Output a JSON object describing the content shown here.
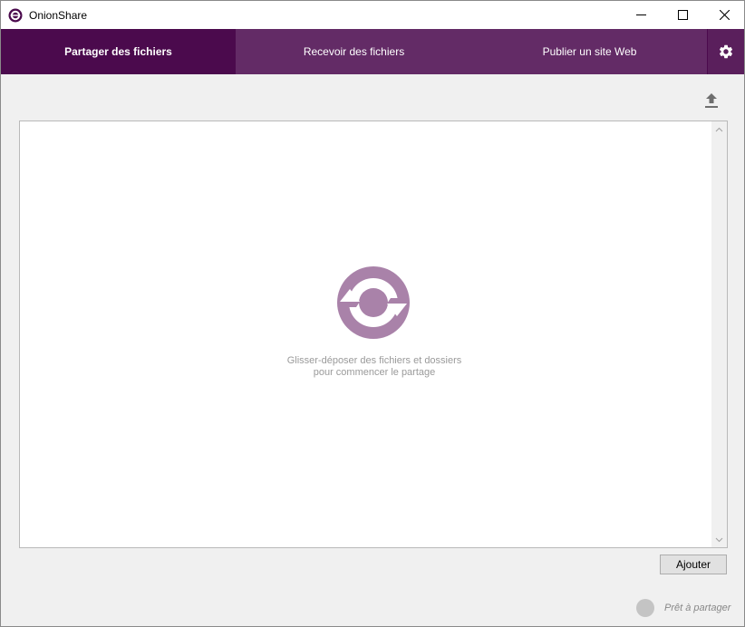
{
  "window": {
    "title": "OnionShare"
  },
  "tabs": [
    {
      "label": "Partager des fichiers",
      "active": true
    },
    {
      "label": "Recevoir des fichiers",
      "active": false
    },
    {
      "label": "Publier un site Web",
      "active": false
    }
  ],
  "dropzone": {
    "line1": "Glisser-déposer des fichiers et dossiers",
    "line2": "pour commencer le partage"
  },
  "actions": {
    "add_label": "Ajouter"
  },
  "status": {
    "text": "Prêt à partager"
  },
  "icons": {
    "app": "onionshare-logo-icon",
    "settings": "gear-icon",
    "upload": "upload-icon",
    "drop": "onionshare-drop-icon"
  },
  "colors": {
    "tab_active": "#4b0a4d",
    "tab_inactive": "#632b66",
    "logo": "#a982a9",
    "status_dot": "#c4c4c4"
  }
}
